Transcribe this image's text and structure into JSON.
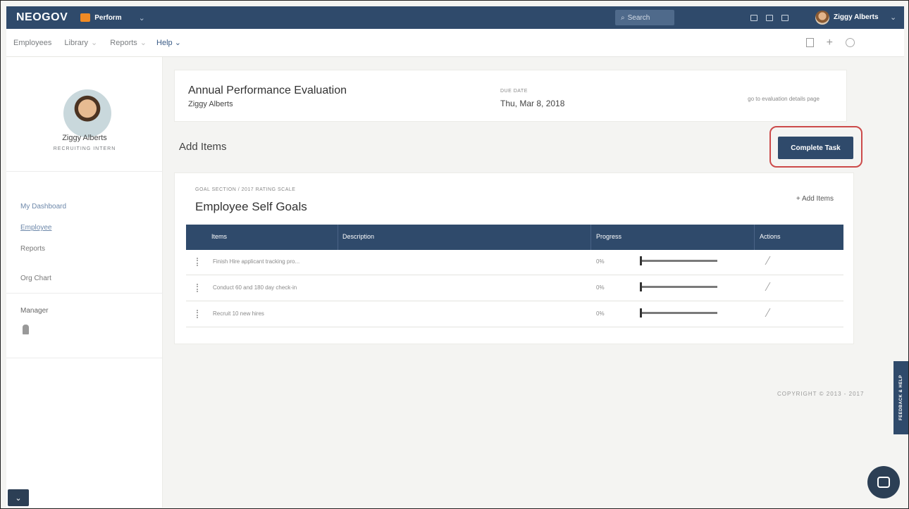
{
  "brand": "NEOGOV",
  "product": {
    "name": "Perform",
    "badge_color": "#f08a24"
  },
  "search": {
    "placeholder": "Search"
  },
  "user": {
    "name": "Ziggy Alberts"
  },
  "nav": {
    "items": [
      {
        "label": "Employees"
      },
      {
        "label": "Library"
      },
      {
        "label": "Reports"
      }
    ],
    "help": "Help"
  },
  "sidebar": {
    "name": "Ziggy Alberts",
    "title": "RECRUITING INTERN",
    "links": [
      "My Dashboard",
      "Employee",
      "Reports",
      "Org Chart"
    ],
    "manager_label": "Manager"
  },
  "evaluation": {
    "title": "Annual Performance Evaluation",
    "employee": "Ziggy Alberts",
    "due_label": "DUE DATE",
    "due_date": "Thu, Mar 8, 2018",
    "link": "go to evaluation details page"
  },
  "main": {
    "heading": "Add Items",
    "complete_button": "Complete Task"
  },
  "goals": {
    "subtitle": "GOAL SECTION / 2017 RATING SCALE",
    "title": "Employee Self Goals",
    "add_link": "+ Add Items",
    "columns": [
      "Items",
      "Description",
      "Progress",
      "Actions"
    ],
    "rows": [
      {
        "item": "Finish Hire applicant tracking pro...",
        "progress": "0%"
      },
      {
        "item": "Conduct 60 and 180 day check-in",
        "progress": "0%"
      },
      {
        "item": "Recruit 10 new hires",
        "progress": "0%"
      }
    ]
  },
  "footer": {
    "copyright": "COPYRIGHT © 2013 - 2017",
    "feedback": "FEEDBACK & HELP"
  },
  "colors": {
    "primary": "#2f4a6b",
    "highlight": "#cc4a4a"
  }
}
